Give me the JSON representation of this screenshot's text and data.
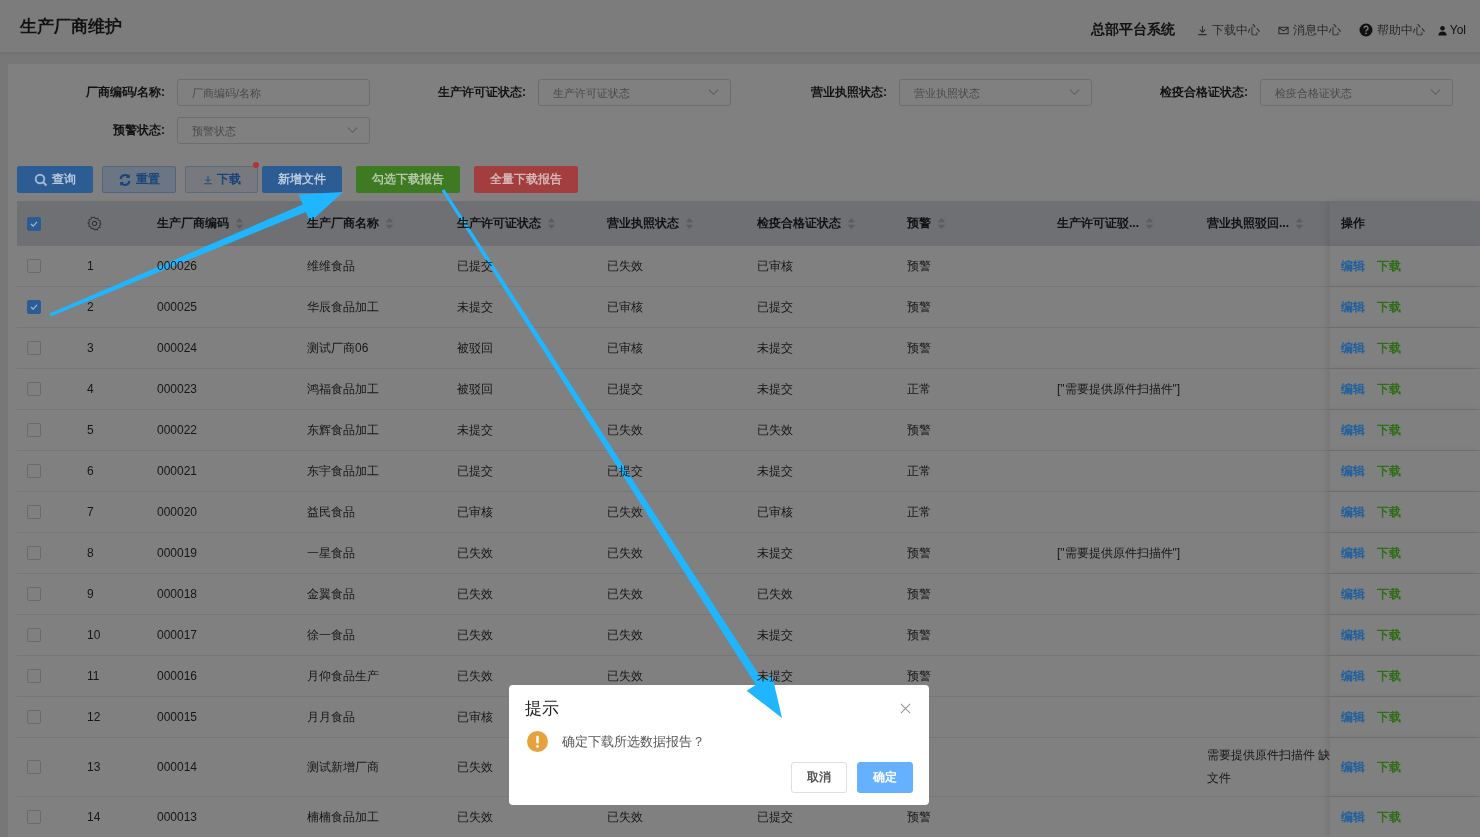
{
  "page": {
    "title": "生产厂商维护"
  },
  "top_nav": {
    "system": "总部平台系统",
    "links": [
      {
        "kind": "download",
        "label": "下载中心"
      },
      {
        "kind": "mail",
        "label": "消息中心"
      },
      {
        "kind": "help",
        "label": "帮助中心"
      },
      {
        "kind": "user",
        "label": "Yol"
      }
    ]
  },
  "filters": [
    {
      "kind": "input",
      "label": "厂商编码/名称:",
      "placeholder": "厂商编码/名称"
    },
    {
      "kind": "select",
      "label": "生产许可证状态:",
      "placeholder": "生产许可证状态"
    },
    {
      "kind": "select",
      "label": "营业执照状态:",
      "placeholder": "营业执照状态"
    },
    {
      "kind": "select",
      "label": "检疫合格证状态:",
      "placeholder": "检疫合格证状态"
    },
    {
      "kind": "select",
      "label": "预警状态:",
      "placeholder": "预警状态"
    }
  ],
  "buttons": [
    {
      "kind": "search",
      "label": "查询"
    },
    {
      "kind": "reset",
      "label": "重置"
    },
    {
      "kind": "download",
      "label": "下载",
      "badge": true
    },
    {
      "kind": "add",
      "label": "新增文件"
    },
    {
      "kind": "check-download",
      "label": "勾选下载报告"
    },
    {
      "kind": "all-download",
      "label": "全量下载报告"
    }
  ],
  "table": {
    "select_all_checked": true,
    "columns": [
      {
        "label": "生产厂商编码",
        "sortable": true
      },
      {
        "label": "生产厂商名称",
        "sortable": true
      },
      {
        "label": "生产许可证状态",
        "sortable": true
      },
      {
        "label": "营业执照状态",
        "sortable": true
      },
      {
        "label": "检疫合格证状态",
        "sortable": true
      },
      {
        "label": "预警",
        "sortable": true
      },
      {
        "label": "生产许可证驳...",
        "sortable": true
      },
      {
        "label": "营业执照驳回...",
        "sortable": true
      },
      {
        "label": "操作",
        "sortable": false
      }
    ],
    "rows": [
      {
        "checked": false,
        "index": "1",
        "cells": [
          "000026",
          "维维食品",
          "已提交",
          "已失效",
          "已审核",
          "预警",
          null,
          null
        ],
        "actions": [
          "编辑",
          "下载"
        ]
      },
      {
        "checked": true,
        "index": "2",
        "cells": [
          "000025",
          "华辰食品加工",
          "未提交",
          "已审核",
          "已提交",
          "预警",
          null,
          null
        ],
        "actions": [
          "编辑",
          "下载"
        ]
      },
      {
        "checked": false,
        "index": "3",
        "cells": [
          "000024",
          "测试厂商06",
          "被驳回",
          "已审核",
          "未提交",
          "预警",
          null,
          null
        ],
        "actions": [
          "编辑",
          "下载"
        ]
      },
      {
        "checked": false,
        "index": "4",
        "cells": [
          "000023",
          "鸿福食品加工",
          "被驳回",
          "已提交",
          "未提交",
          "正常",
          "[\"需要提供原件扫描件\"]",
          null
        ],
        "actions": [
          "编辑",
          "下载"
        ]
      },
      {
        "checked": false,
        "index": "5",
        "cells": [
          "000022",
          "东辉食品加工",
          "未提交",
          "已失效",
          "已失效",
          "预警",
          null,
          null
        ],
        "actions": [
          "编辑",
          "下载"
        ]
      },
      {
        "checked": false,
        "index": "6",
        "cells": [
          "000021",
          "东宇食品加工",
          "已提交",
          "已提交",
          "未提交",
          "正常",
          null,
          null
        ],
        "actions": [
          "编辑",
          "下载"
        ]
      },
      {
        "checked": false,
        "index": "7",
        "cells": [
          "000020",
          "益民食品",
          "已审核",
          "已失效",
          "已审核",
          "正常",
          null,
          null
        ],
        "actions": [
          "编辑",
          "下载"
        ]
      },
      {
        "checked": false,
        "index": "8",
        "cells": [
          "000019",
          "一星食品",
          "已失效",
          "已失效",
          "未提交",
          "预警",
          "[\"需要提供原件扫描件\"]",
          null
        ],
        "actions": [
          "编辑",
          "下载"
        ]
      },
      {
        "checked": false,
        "index": "9",
        "cells": [
          "000018",
          "金翼食品",
          "已失效",
          "已失效",
          "已失效",
          "预警",
          null,
          null
        ],
        "actions": [
          "编辑",
          "下载"
        ]
      },
      {
        "checked": false,
        "index": "10",
        "cells": [
          "000017",
          "徐一食品",
          "已失效",
          "已失效",
          "未提交",
          "预警",
          null,
          null
        ],
        "actions": [
          "编辑",
          "下载"
        ]
      },
      {
        "checked": false,
        "index": "11",
        "cells": [
          "000016",
          "月仰食品生产",
          "已失效",
          "已失效",
          "未提交",
          "预警",
          null,
          null
        ],
        "actions": [
          "编辑",
          "下载"
        ]
      },
      {
        "checked": false,
        "index": "12",
        "cells": [
          "000015",
          "月月食品",
          "已审核",
          null,
          null,
          null,
          null,
          null
        ],
        "actions": [
          "编辑",
          "下载"
        ]
      },
      {
        "checked": false,
        "index": "13",
        "cells": [
          "000014",
          "测试新增厂商",
          "已失效",
          null,
          null,
          null,
          null,
          "需要提供原件扫描件 缺文件"
        ],
        "actions": [
          "编辑",
          "下载"
        ]
      },
      {
        "checked": false,
        "index": "14",
        "cells": [
          "000013",
          "楠楠食品加工",
          "已失效",
          "已失效",
          "已提交",
          "预警",
          null,
          null
        ],
        "actions": [
          "编辑",
          "下载"
        ]
      }
    ]
  },
  "dialog": {
    "title": "提示",
    "message": "确定下载所选数据报告？",
    "buttons": [
      {
        "kind": "cancel",
        "label": "取消"
      },
      {
        "kind": "confirm",
        "label": "确定"
      }
    ]
  },
  "annotations": [
    {
      "kind": "arrow"
    },
    {
      "kind": "arrow"
    }
  ]
}
